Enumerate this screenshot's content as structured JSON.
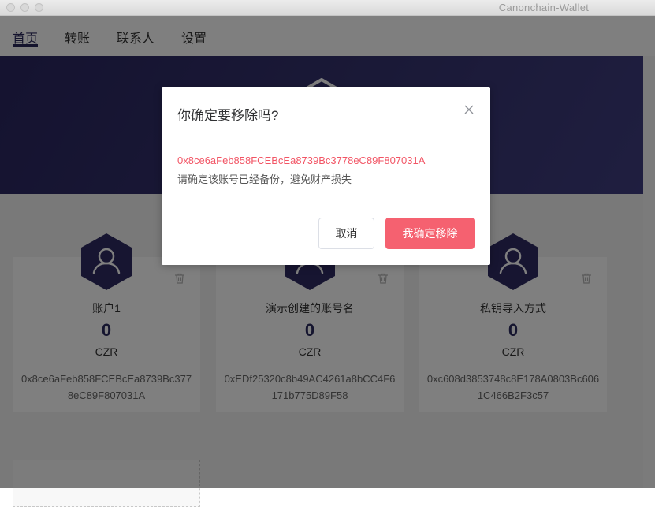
{
  "window": {
    "title": "Canonchain-Wallet"
  },
  "nav": {
    "tabs": [
      {
        "label": "首页"
      },
      {
        "label": "转账"
      },
      {
        "label": "联系人"
      },
      {
        "label": "设置"
      }
    ],
    "active_index": 0
  },
  "accounts": [
    {
      "name": "账户1",
      "balance": "0",
      "unit": "CZR",
      "address": "0x8ce6aFeb858FCEBcEa8739Bc3778eC89F807031A"
    },
    {
      "name": "演示创建的账号名",
      "balance": "0",
      "unit": "CZR",
      "address": "0xEDf25320c8b49AC4261a8bCC4F6171b775D89F58"
    },
    {
      "name": "私钥导入方式",
      "balance": "0",
      "unit": "CZR",
      "address": "0xc608d3853748c8E178A0803Bc6061C466B2F3c57"
    }
  ],
  "dialog": {
    "title": "你确定要移除吗?",
    "address": "0x8ce6aFeb858FCEBcEa8739Bc3778eC89F807031A",
    "message": "请确定该账号已经备份，避免财产损失",
    "cancel_label": "取消",
    "confirm_label": "我确定移除"
  },
  "colors": {
    "primary": "#2b2a5e",
    "danger": "#f56170",
    "address_red": "#f25565"
  },
  "icons": [
    "trash-icon",
    "user-icon",
    "close-icon",
    "wallet-logo-icon"
  ]
}
